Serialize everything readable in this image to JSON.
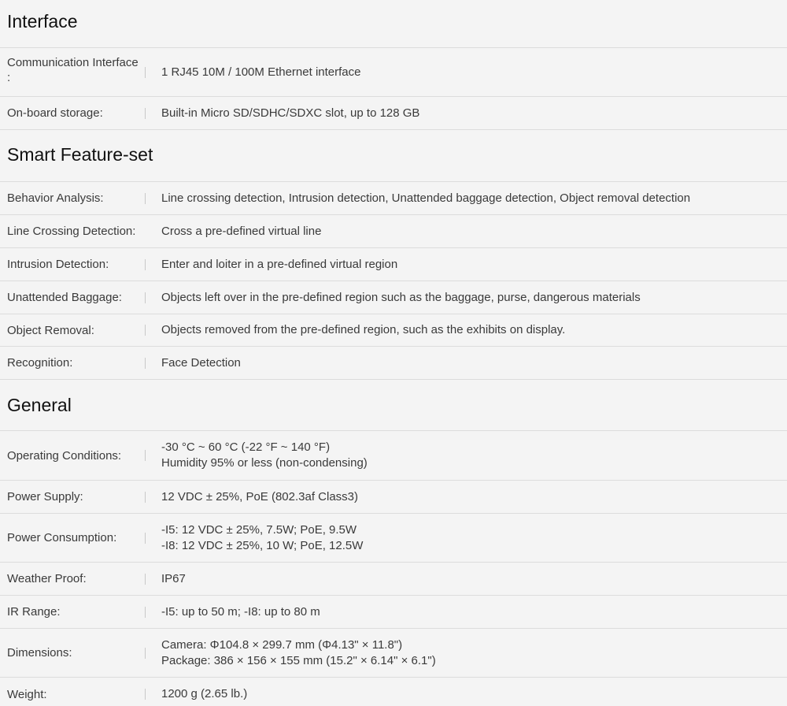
{
  "sections": [
    {
      "title": "Interface",
      "rows": [
        {
          "label": "Communication Interface",
          "label_extra": ":",
          "values": [
            "1 RJ45 10M / 100M Ethernet interface"
          ]
        },
        {
          "label": "On-board storage:",
          "values": [
            "Built-in Micro SD/SDHC/SDXC slot, up to 128 GB"
          ]
        }
      ]
    },
    {
      "title": "Smart Feature-set",
      "rows": [
        {
          "label": "Behavior Analysis:",
          "values": [
            "Line crossing detection, Intrusion detection, Unattended baggage detection, Object removal detection"
          ]
        },
        {
          "label": "Line Crossing Detection:",
          "values": [
            "Cross a pre-defined virtual line"
          ]
        },
        {
          "label": "Intrusion Detection:",
          "values": [
            "Enter and loiter in a pre-defined virtual region"
          ]
        },
        {
          "label": "Unattended Baggage:",
          "values": [
            "Objects left over in the pre-defined region such as the baggage, purse, dangerous materials"
          ]
        },
        {
          "label": "Object Removal:",
          "values": [
            "Objects removed from the pre-defined region, such as the exhibits on display."
          ]
        },
        {
          "label": "Recognition:",
          "values": [
            "Face Detection"
          ]
        }
      ]
    },
    {
      "title": "General",
      "rows": [
        {
          "label": "Operating Conditions:",
          "values": [
            "-30 °C ~ 60 °C (-22 °F ~ 140 °F)",
            "Humidity 95% or less (non-condensing)"
          ]
        },
        {
          "label": "Power Supply:",
          "values": [
            "12 VDC ± 25%, PoE (802.3af Class3)"
          ]
        },
        {
          "label": "Power Consumption:",
          "values": [
            "-I5: 12 VDC ± 25%, 7.5W; PoE, 9.5W",
            "-I8: 12 VDC ± 25%, 10 W; PoE, 12.5W"
          ]
        },
        {
          "label": "Weather Proof:",
          "values": [
            "IP67"
          ]
        },
        {
          "label": "IR Range:",
          "values": [
            "-I5: up to 50 m; -I8: up to 80 m"
          ]
        },
        {
          "label": "Dimensions:",
          "values": [
            "Camera: Φ104.8 × 299.7 mm (Φ4.13\" × 11.8\")",
            "Package: 386 × 156 × 155 mm (15.2\" × 6.14\" × 6.1\")"
          ]
        },
        {
          "label": "Weight:",
          "values": [
            "1200 g (2.65 lb.)"
          ]
        }
      ]
    }
  ]
}
